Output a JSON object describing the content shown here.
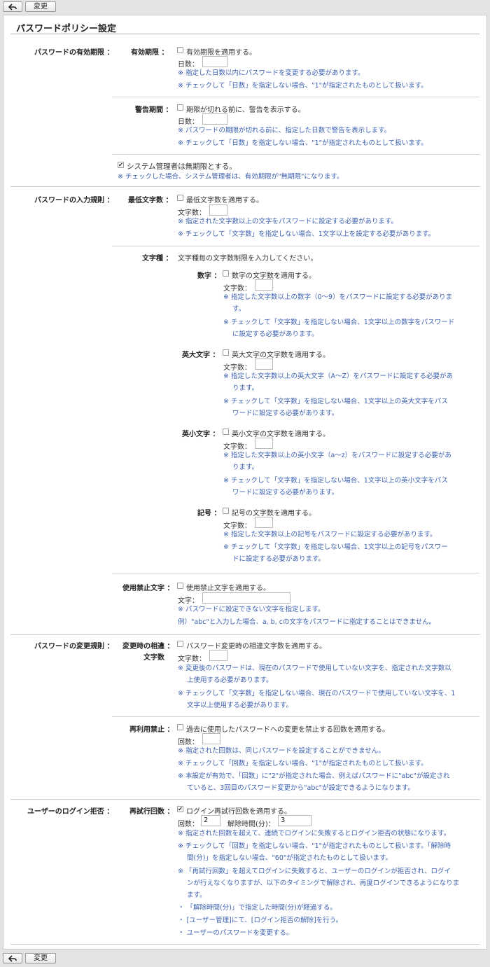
{
  "toolbar": {
    "change_label": "変更",
    "back_icon": "back-arrow-icon"
  },
  "title": "パスワードポリシー設定",
  "expiry": {
    "section": "パスワードの有効期限 ：",
    "validity": {
      "label": "有効期限 ：",
      "check": "有効期限を適用する。",
      "checked": false,
      "days_label": "日数：",
      "days_value": "",
      "note1": "※ 指定した日数以内にパスワードを変更する必要があります。",
      "note2": "※ チェックして「日数」を指定しない場合、\"1\"が指定されたものとして扱います。"
    },
    "warning": {
      "label": "警告期間 ：",
      "check": "期限が切れる前に、警告を表示する。",
      "checked": false,
      "days_label": "日数：",
      "days_value": "",
      "note1": "※ パスワードの期限が切れる前に、指定した日数で警告を表示します。",
      "note2": "※ チェックして「日数」を指定しない場合、\"1\"が指定されたものとして扱います。"
    },
    "admin": {
      "check": "システム管理者は無期限とする。",
      "checked": true,
      "note": "※ チェックした場合、システム管理者は、有効期限が\"無期限\"になります。"
    }
  },
  "input_rules": {
    "section": "パスワードの入力規則 ：",
    "min": {
      "label": "最低文字数 ：",
      "check": "最低文字数を適用する。",
      "checked": false,
      "count_label": "文字数：",
      "count_value": "",
      "note1": "※ 指定された文字数以上の文字をパスワードに設定する必要があります。",
      "note2": "※ チェックして「文字数」を指定しない場合、1文字以上を設定する必要があります。"
    },
    "types": {
      "label": "文字種 ：",
      "desc": "文字種毎の文字数制限を入力してください。",
      "digit": {
        "label": "数字 ：",
        "check": "数字の文字数を適用する。",
        "checked": false,
        "count_label": "文字数：",
        "count_value": "",
        "note1a": "※ 指定した文字数以上の数字（0～9）をパスワードに設定する必要がありま",
        "note1b": "す。",
        "note2a": "※ チェックして「文字数」を指定しない場合、1文字以上の数字をパスワード",
        "note2b": "に設定する必要があります。"
      },
      "upper": {
        "label": "英大文字 ：",
        "check": "英大文字の文字数を適用する。",
        "checked": false,
        "count_label": "文字数：",
        "count_value": "",
        "note1a": "※ 指定した文字数以上の英大文字（A～Z）をパスワードに設定する必要があ",
        "note1b": "ります。",
        "note2a": "※ チェックして「文字数」を指定しない場合、1文字以上の英大文字をパス",
        "note2b": "ワードに設定する必要があります。"
      },
      "lower": {
        "label": "英小文字 ：",
        "check": "英小文字の文字数を適用する。",
        "checked": false,
        "count_label": "文字数：",
        "count_value": "",
        "note1a": "※ 指定した文字数以上の英小文字（a～z）をパスワードに設定する必要があ",
        "note1b": "ります。",
        "note2a": "※ チェックして「文字数」を指定しない場合、1文字以上の英小文字をパス",
        "note2b": "ワードに設定する必要があります。"
      },
      "symbol": {
        "label": "記号 ：",
        "check": "記号の文字数を適用する。",
        "checked": false,
        "count_label": "文字数：",
        "count_value": "",
        "note1a": "※ 指定した文字数以上の記号をパスワードに設定する必要があります。",
        "note2a": "※ チェックして「文字数」を指定しない場合、1文字以上の記号をパスワー",
        "note2b": "ドに設定する必要があります。"
      }
    },
    "forbidden": {
      "label": "使用禁止文字 ：",
      "check": "使用禁止文字を適用する。",
      "checked": false,
      "chars_label": "文字：",
      "chars_value": "",
      "note1": "※ パスワードに設定できない文字を指定します。",
      "note2": "例）\"abc\"と入力した場合、a, b, cの文字をパスワードに指定することはできません。"
    }
  },
  "change_rules": {
    "section": "パスワードの変更規則 ：",
    "diff": {
      "label_a": "変更時の相違 ：",
      "label_b": "文字数",
      "check": "パスワード変更時の相違文字数を適用する。",
      "checked": false,
      "count_label": "文字数：",
      "count_value": "",
      "note1a": "※ 変更後のパスワードは、現在のパスワードで使用していない文字を、指定された文字数以",
      "note1b": "上使用する必要があります。",
      "note2a": "※ チェックして「文字数」を指定しない場合、現在のパスワードで使用していない文字を、1",
      "note2b": "文字以上使用する必要があります。"
    },
    "reuse": {
      "label": "再利用禁止 ：",
      "check": "過去に使用したパスワードへの変更を禁止する回数を適用する。",
      "checked": false,
      "count_label": "回数：",
      "count_value": "",
      "note1": "※ 指定された回数は、同じパスワードを設定することができません。",
      "note2": "※ チェックして「回数」を指定しない場合、\"1\"が指定されたものとして扱います。",
      "note3a": "※ 本設定が有効で、「回数」に\"2\"が指定された場合、例えばパスワードに\"abc\"が設定され",
      "note3b": "ていると、3回目のパスワード変更から\"abc\"が設定できるようになります。"
    }
  },
  "lockout": {
    "section": "ユーザーのログイン拒否 ：",
    "retry": {
      "label": "再試行回数 ：",
      "check": "ログイン再試行回数を適用する。",
      "checked": true,
      "count_label": "回数：",
      "count_value": "2",
      "release_label": "解除時間(分)：",
      "release_value": "3",
      "note1": "※ 指定された回数を超えて、連続でログインに失敗するとログイン拒否の状態になります。",
      "note2a": "※ チェックして「回数」を指定しない場合、\"1\"が指定されたものとして扱います。「解除時",
      "note2b": "間(分)」を指定しない場合、\"60\"が指定されたものとして扱います。",
      "note3a": "※ 「再試行回数」を超えてログインに失敗すると、ユーザーのログインが拒否され、ログイ",
      "note3b": "ンが行えなくなりますが、以下のタイミングで解除され、再度ログインできるようになりま",
      "note3c": "ます。",
      "bullet1": "・ 「解除時間(分)」で指定した時間(分)が経過する。",
      "bullet2": "・ [ユーザー管理]にて、[ログイン拒否の解除]を行う。",
      "bullet3": "・ ユーザーのパスワードを変更する。"
    }
  }
}
